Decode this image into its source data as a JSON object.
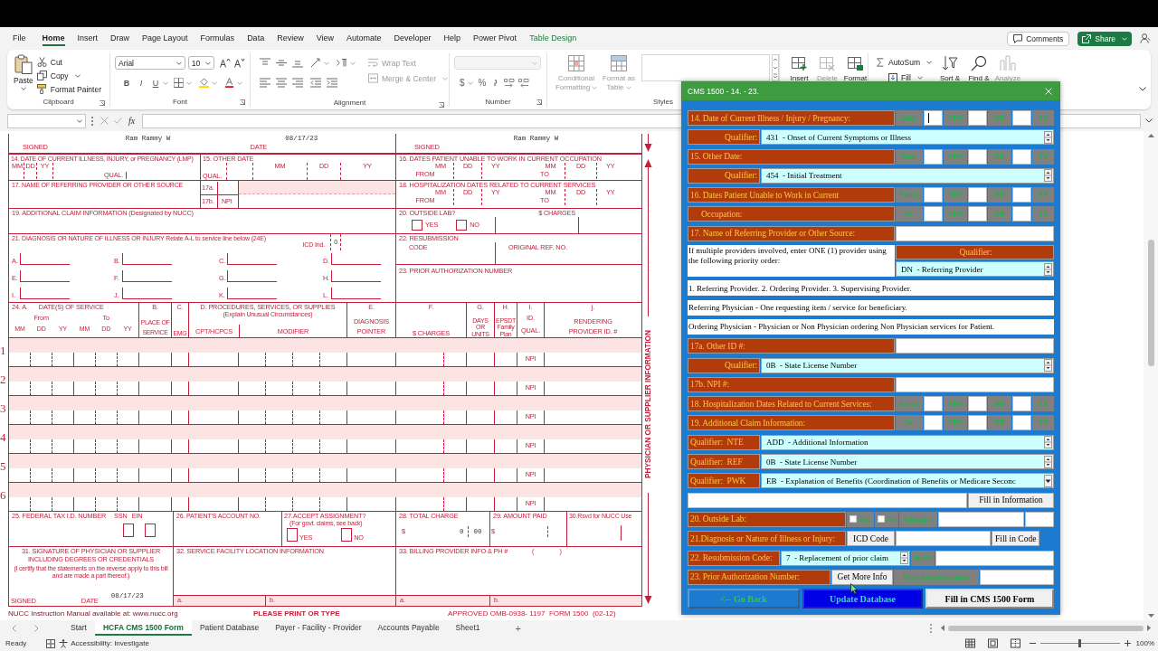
{
  "menu_tabs": [
    {
      "label": "File",
      "selected": false,
      "kind": "standard"
    },
    {
      "label": "Home",
      "selected": true,
      "kind": "standard"
    },
    {
      "label": "Insert",
      "selected": false,
      "kind": "standard"
    },
    {
      "label": "Draw",
      "selected": false,
      "kind": "standard"
    },
    {
      "label": "Page Layout",
      "selected": false,
      "kind": "standard"
    },
    {
      "label": "Formulas",
      "selected": false,
      "kind": "standard"
    },
    {
      "label": "Data",
      "selected": false,
      "kind": "standard"
    },
    {
      "label": "Review",
      "selected": false,
      "kind": "standard"
    },
    {
      "label": "View",
      "selected": false,
      "kind": "standard"
    },
    {
      "label": "Automate",
      "selected": false,
      "kind": "standard"
    },
    {
      "label": "Developer",
      "selected": false,
      "kind": "standard"
    },
    {
      "label": "Help",
      "selected": false,
      "kind": "standard"
    },
    {
      "label": "Power Pivot",
      "selected": false,
      "kind": "standard"
    },
    {
      "label": "Table Design",
      "selected": false,
      "kind": "contextual"
    }
  ],
  "top_buttons": {
    "comments": "Comments",
    "share": "Share"
  },
  "ribbon": {
    "clipboard": {
      "paste": "Paste",
      "cut": "Cut",
      "copy": "Copy",
      "format_painter": "Format Painter",
      "group_label": "Clipboard"
    },
    "font": {
      "font_name": "Arial",
      "font_size": "10",
      "style_buttons": [
        "B",
        "I",
        "U"
      ],
      "group_label": "Font"
    },
    "alignment": {
      "buttons": [
        {
          "label": "Wrap Text",
          "disabled": true
        },
        {
          "label": "Merge & Center",
          "disabled": true
        }
      ],
      "group_label": "Alignment"
    },
    "number": {
      "symbols": [
        "$",
        "%"
      ],
      "group_label": "Number"
    },
    "styles": {
      "buttons": [
        {
          "label": "Conditional Formatting",
          "disabled": true
        },
        {
          "label": "Format as Table",
          "disabled": true
        }
      ],
      "group_label": "Styles"
    },
    "cells": [
      {
        "label": "Insert",
        "disabled": false
      },
      {
        "label": "Delete",
        "disabled": true
      },
      {
        "label": "Format",
        "disabled": false
      }
    ],
    "editing": {
      "autosum": "AutoSum",
      "fill": "Fill",
      "buttons": [
        {
          "label": "Sort &",
          "disabled": false
        },
        {
          "label": "Find &",
          "disabled": false
        },
        {
          "label": "Analyze",
          "disabled": true
        }
      ]
    }
  },
  "formula_bar": {
    "function_button": "fx"
  },
  "form": {
    "signature_row": {
      "left_signed": "SIGNED",
      "left_name": "Ram Rammy W",
      "date_label": "DATE",
      "date": "08/17/23",
      "right_signed": "SIGNED",
      "right_name": "Ram Rammy W"
    },
    "box14": {
      "title": "14. DATE OF CURRENT ILLNESS, INJURY, or PREGNANCY (LMP)",
      "date_parts": [
        "MM",
        "DD",
        "YY"
      ],
      "qual": "QUAL."
    },
    "box15": {
      "title": "15. OTHER DATE",
      "qual": "QUAL.",
      "date_parts": [
        "MM",
        "DD",
        "YY"
      ]
    },
    "box16": {
      "title": "16. DATES PATIENT UNABLE TO WORK IN CURRENT OCCUPATION",
      "date_parts": [
        "MM",
        "DD",
        "YY",
        "MM",
        "DD",
        "YY"
      ],
      "from": "FROM",
      "to": "TO"
    },
    "box17": {
      "title": "17. NAME OF REFERRING PROVIDER OR OTHER SOURCE",
      "a": "17a.",
      "b": "17b.",
      "npi": "NPI"
    },
    "box18": {
      "title": "18. HOSPITALIZATION DATES RELATED TO CURRENT SERVICES",
      "date_parts": [
        "MM",
        "DD",
        "YY",
        "MM",
        "DD",
        "YY"
      ],
      "from": "FROM",
      "to": "TO"
    },
    "box19": {
      "title": "19. ADDITIONAL CLAIM INFORMATION (Designated by NUCC)"
    },
    "box20": {
      "title": "20. OUTSIDE LAB?",
      "charges": "$ CHARGES",
      "yes": "YES",
      "no": "NO"
    },
    "box21": {
      "title": "21. DIAGNOSIS OR NATURE OF ILLNESS OR INJURY Relate A-L to service line below (24E)",
      "icd_label": "ICD Ind.",
      "icd_value": "0",
      "letters": [
        "A.",
        "B.",
        "C.",
        "D.",
        "E.",
        "F.",
        "G.",
        "H.",
        "I.",
        "J.",
        "K.",
        "L."
      ]
    },
    "box22": {
      "title": "22. RESUBMISSION",
      "code": "CODE",
      "original": "ORIGINAL REF. NO."
    },
    "box23": {
      "title": "23. PRIOR AUTHORIZATION NUMBER"
    },
    "box24": {
      "a": "24. A.",
      "dates": "DATE(S) OF SERVICE",
      "from": "From",
      "to": "To",
      "date_parts": [
        "MM",
        "DD",
        "YY",
        "MM",
        "DD",
        "YY"
      ],
      "b": {
        "letter": "B.",
        "heading": [
          "PLACE OF",
          "SERVICE"
        ]
      },
      "c": {
        "letter": "C.",
        "heading": [
          "EMG"
        ]
      },
      "d": "D. PROCEDURES, SERVICES, OR SUPPLIES",
      "d_note": "(Explain Unusual Circumstances)",
      "cpt": "CPT/HCPCS",
      "modifier": "MODIFIER",
      "e": {
        "letter": "E.",
        "heading": [
          "DIAGNOSIS",
          "POINTER"
        ]
      },
      "f": {
        "letter": "F.",
        "heading": [
          "$ CHARGES"
        ]
      },
      "g": {
        "letter": "G.",
        "heading": [
          "DAYS",
          "OR",
          "UNITS"
        ]
      },
      "h": {
        "letter": "H.",
        "heading": [
          "EPSDT",
          "Family",
          "Plan"
        ]
      },
      "i": {
        "letter": "I.",
        "heading": [
          "ID.",
          "QUAL."
        ]
      },
      "j": {
        "letter": "j.",
        "heading": [
          "RENDERING",
          "PROVIDER ID. #"
        ]
      }
    },
    "lines": [
      {
        "number": "1",
        "qual": "NPI"
      },
      {
        "number": "2",
        "qual": "NPI"
      },
      {
        "number": "3",
        "qual": "NPI"
      },
      {
        "number": "4",
        "qual": "NPI"
      },
      {
        "number": "5",
        "qual": "NPI"
      },
      {
        "number": "6",
        "qual": "NPI"
      }
    ],
    "box25": {
      "title": "25. FEDERAL TAX I.D. NUMBER",
      "ssn": "SSN",
      "ein": "EIN"
    },
    "box26": {
      "title": "26. PATIENT'S ACCOUNT NO."
    },
    "box27": {
      "title": "27.ACCEPT ASSIGNMENT?",
      "note": "(For govt. claims, see back)",
      "yes": "YES",
      "no": "NO"
    },
    "box28": {
      "title": "28. TOTAL CHARGE",
      "currency": "$",
      "dollars": "0",
      "cents": "00"
    },
    "box29": {
      "title": "29. AMOUNT PAID",
      "currency": "$"
    },
    "box30": {
      "title": "30.Rsvd for NUCC Use"
    },
    "box31": {
      "title": "31. SIGNATURE OF PHYSICIAN OR SUPPLIER INCLUDING DEGREES OR CREDENTIALS",
      "note": "(I certify that the statements on the reverse apply to this bill and are made a part thereof.)",
      "signed": "SIGNED",
      "date_label": "DATE",
      "date": "08/17/23"
    },
    "box32": {
      "title": "32. SERVICE FACILITY LOCATION INFORMATION",
      "a": "a.",
      "b": "b."
    },
    "box33": {
      "title": "33. BILLING PROVIDER INFO & PH #",
      "phone_open": "(",
      "phone_close": ")",
      "a": "a.",
      "b": "b."
    },
    "footer": {
      "manual": "NUCC Instruction Manual available at: www.nucc.org",
      "notice": "PLEASE PRINT OR TYPE",
      "approval": "APPROVED OMB-0938- 1197  FORM 1500  (02-12)"
    },
    "side_label": "PHYSICIAN OR SUPPLIER INFORMATION"
  },
  "dialog": {
    "title": "CMS 1500 - 14. - 23.",
    "rows": [
      {
        "kind": "date",
        "label": "14. Date of Current Illness / Injury / Pregnancy:",
        "prefix": "Date:",
        "parts": [
          "MM",
          "DD",
          "YY"
        ],
        "focused": true,
        "indent": false
      },
      {
        "kind": "qualifier",
        "label": "Qualifier:",
        "value": "431  - Onset of Current Symptoms or Illness",
        "picker": {
          "kind": "spin"
        }
      },
      {
        "kind": "date",
        "label": "15. Other Date:",
        "prefix": "Date:",
        "parts": [
          "MM",
          "DD",
          "YY"
        ],
        "focused": false,
        "indent": false
      },
      {
        "kind": "qualifier",
        "label": "Qualifier:",
        "value": "454  - Initial Treatment",
        "picker": {
          "kind": "spin"
        }
      },
      {
        "kind": "date",
        "label": "16. Dates Patient Unable to Work in Current",
        "prefix": "From:",
        "parts": [
          "MM",
          "DD",
          "YY"
        ],
        "focused": false,
        "indent": false
      },
      {
        "kind": "date",
        "label": "Occupation:",
        "prefix": "To:",
        "parts": [
          "MM",
          "DD",
          "YY"
        ],
        "focused": false,
        "indent": true
      },
      {
        "kind": "text",
        "label": "17. Name of Referring Provider or Other Source:"
      },
      {
        "kind": "note_qualifier",
        "note": "If multiple providers involved, enter ONE (1) provider using the following priority order:",
        "header": "Qualifier:",
        "value": "DN  - Referring Provider",
        "picker": {
          "kind": "spin"
        }
      },
      {
        "kind": "note",
        "text": "1. Referring Provider. 2. Ordering Provider. 3. Supervising Provider."
      },
      {
        "kind": "note",
        "text": "Referring Physician - One requesting item / service for beneficiary."
      },
      {
        "kind": "note",
        "text": "Ordering Physician - Physician or Non Physician ordering Non Physician services for Patient."
      },
      {
        "kind": "text",
        "label": "17a. Other ID #:"
      },
      {
        "kind": "qualifier",
        "label": "Qualifier:",
        "value": "0B  - State License Number",
        "picker": {
          "kind": "spin"
        }
      },
      {
        "kind": "text",
        "label": "17b. NPI #:"
      },
      {
        "kind": "date",
        "label": "18. Hospitalization Dates Related to Current Services:",
        "prefix": "From:",
        "parts": [
          "MM",
          "DD",
          "YY"
        ],
        "focused": false,
        "indent": false
      },
      {
        "kind": "date",
        "label": "19. Additional Claim Information:",
        "prefix": "To:",
        "parts": [
          "MM",
          "DD",
          "YY"
        ],
        "focused": false,
        "indent": false
      },
      {
        "kind": "coded_qualifier",
        "label": "Qualifier:  NTE",
        "value": "ADD  - Additional Information",
        "picker": {
          "kind": "spin"
        }
      },
      {
        "kind": "coded_qualifier",
        "label": "Qualifier:  REF",
        "value": "0B  - State License Number",
        "picker": {
          "kind": "spin"
        }
      },
      {
        "kind": "coded_qualifier",
        "label": "Qualifier:  PWK",
        "value": "EB  - Explanation of Benefits (Coordination of Benefits or Medicare Seconc",
        "picker": {
          "kind": "dropdown"
        }
      },
      {
        "kind": "fill",
        "button": "Fill in Information"
      },
      {
        "kind": "outside_lab",
        "label": "20. Outside Lab:",
        "options": [
          {
            "label": "Yes",
            "checked": false
          },
          {
            "label": "No",
            "checked": false
          }
        ],
        "charges": "Charges:"
      },
      {
        "kind": "diagnosis",
        "label": "21.Diagnosis or Nature of Illness or Injury:",
        "field_label": "ICD Code",
        "button": "Fill in Code"
      },
      {
        "kind": "resubmission",
        "label": "22. Resubmission Code:",
        "value": "7  - Replacement of prior claim",
        "picker": {
          "kind": "spin"
        },
        "ref": "Ref#:"
      },
      {
        "kind": "prior_auth",
        "label": "23. Prior Authorization Number:",
        "button": "Get More Info",
        "field_label": "Prior Authorization #"
      }
    ],
    "buttons": [
      {
        "label": "<-- Go Back",
        "kind": "back"
      },
      {
        "label": "Update Database",
        "kind": "update"
      },
      {
        "label": "Fill in CMS 1500 Form",
        "kind": "fill"
      }
    ]
  },
  "sheet_tabs": [
    {
      "label": "Start",
      "selected": false
    },
    {
      "label": "HCFA CMS 1500 Form",
      "selected": true
    },
    {
      "label": "Patient Database",
      "selected": false
    },
    {
      "label": "Payer - Facility - Provider",
      "selected": false
    },
    {
      "label": "Accounts Payable",
      "selected": false
    },
    {
      "label": "Sheet1",
      "selected": false
    }
  ],
  "add_sheet": "+",
  "status_bar": {
    "ready": "Ready",
    "accessibility": "Accessibility: Investigate",
    "zoom_slider": {
      "level": 0.5
    },
    "zoom": "100%"
  }
}
